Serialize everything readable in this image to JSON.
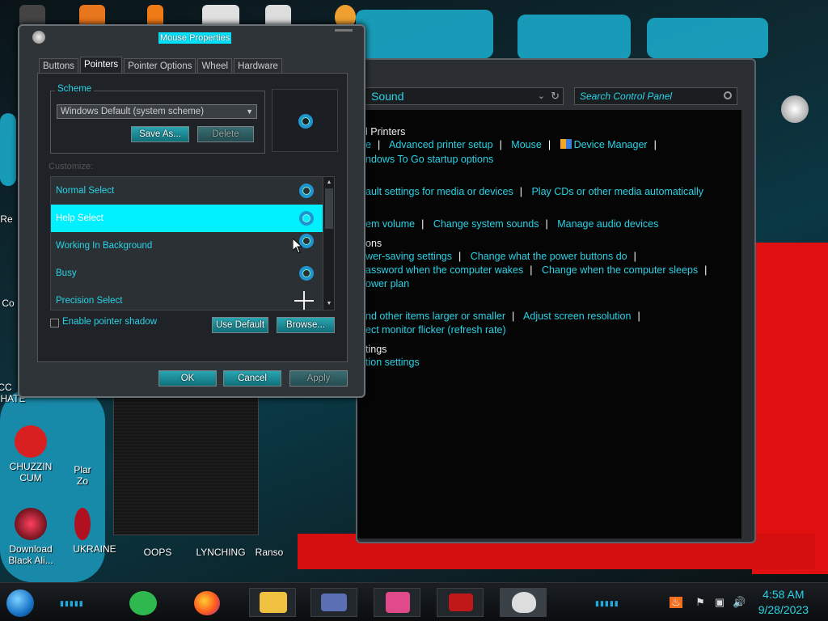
{
  "desktop": {
    "icons": [
      {
        "label": "CHUZZIN\nCUM",
        "color": "#d82020"
      },
      {
        "label": "Download\nBlack Ali...",
        "color": "#a0101a"
      },
      {
        "label": "UKRAINE",
        "color": "#b01020"
      },
      {
        "label": "OOPS",
        "color": "#333333"
      },
      {
        "label": "LYNCHING",
        "color": "#333333"
      },
      {
        "label": "Ranso",
        "color": "#333333"
      }
    ],
    "partial_labels": [
      "Re",
      "Co",
      "CC",
      "HATE",
      "Plar",
      "Zo"
    ]
  },
  "control_panel": {
    "address": "Sound",
    "search_placeholder": "Search Control Panel",
    "lines": [
      {
        "type": "head",
        "text": "l Printers"
      },
      {
        "type": "links",
        "items": [
          "e",
          "Advanced printer setup",
          "Mouse",
          "Device Manager"
        ]
      },
      {
        "type": "links",
        "items": [
          "ndows To Go startup options"
        ]
      },
      {
        "type": "links",
        "items": [
          "ault settings for media or devices",
          "Play CDs or other media automatically"
        ]
      },
      {
        "type": "links",
        "items": [
          "em volume",
          "Change system sounds",
          "Manage audio devices"
        ]
      },
      {
        "type": "head",
        "text": "ons"
      },
      {
        "type": "links",
        "items": [
          "wer-saving settings",
          "Change what the power buttons do"
        ]
      },
      {
        "type": "links",
        "items": [
          "assword when the computer wakes",
          "Change when the computer sleeps"
        ]
      },
      {
        "type": "links",
        "items": [
          "ower plan"
        ]
      },
      {
        "type": "links",
        "items": [
          "nd other items larger or smaller",
          "Adjust screen resolution"
        ]
      },
      {
        "type": "links",
        "items": [
          "ect monitor flicker (refresh rate)"
        ]
      },
      {
        "type": "head",
        "text": "tings"
      },
      {
        "type": "links",
        "items": [
          "tion settings"
        ]
      }
    ]
  },
  "dialog": {
    "title": "Mouse Properties",
    "tabs": [
      "Buttons",
      "Pointers",
      "Pointer Options",
      "Wheel",
      "Hardware"
    ],
    "active_tab": "Pointers",
    "scheme_label": "Scheme",
    "scheme_value": "Windows Default (system scheme)",
    "save_as": "Save As...",
    "delete": "Delete",
    "customize_label": "Customize:",
    "pointers": [
      {
        "name": "Normal Select",
        "icon": "busy-ring-icon"
      },
      {
        "name": "Help Select",
        "icon": "busy-ring-icon",
        "selected": true
      },
      {
        "name": "Working In Background",
        "icon": "busy-ring-icon"
      },
      {
        "name": "Busy",
        "icon": "busy-ring-icon"
      },
      {
        "name": "Precision Select",
        "icon": "crosshair-icon"
      }
    ],
    "shadow_label": "Enable pointer shadow",
    "shadow_checked": false,
    "use_default": "Use Default",
    "browse": "Browse...",
    "ok": "OK",
    "cancel": "Cancel",
    "apply": "Apply"
  },
  "taskbar": {
    "time": "4:58 AM",
    "date": "9/28/2023",
    "apps": [
      "task-app-icon",
      "firefox-icon",
      "file-explorer-icon",
      "control-panel-icon",
      "media-icon",
      "red-app-icon",
      "mouse-app-icon"
    ],
    "tray": [
      "java-icon",
      "flag-icon",
      "network-icon",
      "volume-icon"
    ]
  },
  "colors": {
    "accent": "#29d3e6",
    "selection": "#00f0ff",
    "red": "#e01010"
  }
}
